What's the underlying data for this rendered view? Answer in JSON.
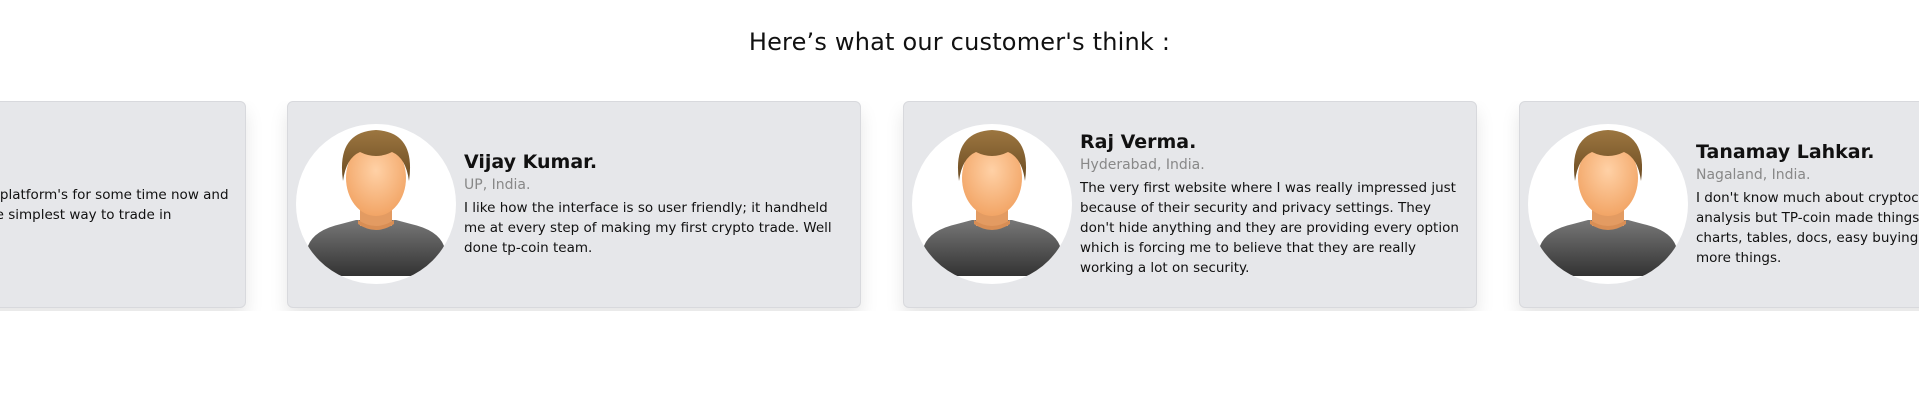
{
  "heading": "Here’s what our customer's think :",
  "testimonials": [
    {
      "name": "",
      "location": "",
      "quote": "I have been using the platform's for some time now and have found it to be the simplest way to trade in"
    },
    {
      "name": "Vijay Kumar.",
      "location": "UP, India.",
      "quote": "I like how the interface is so user friendly; it handheld me at every step of making my first crypto trade. Well done tp-coin team."
    },
    {
      "name": "Raj Verma.",
      "location": "Hyderabad, India.",
      "quote": "The very first website where I was really impressed just because of their security and privacy settings. They don't hide anything and they are providing every option which is forcing me to believe that they are really working a lot on security."
    },
    {
      "name": "Tanamay Lahkar.",
      "location": "Nagaland, India.",
      "quote": "I don't know much about cryptocurrency, but with their analysis but TP-coin made things easy for me, news, charts, tables, docs, easy buying and selling and much more things."
    }
  ],
  "icons": {
    "avatar": "user-avatar-icon"
  }
}
